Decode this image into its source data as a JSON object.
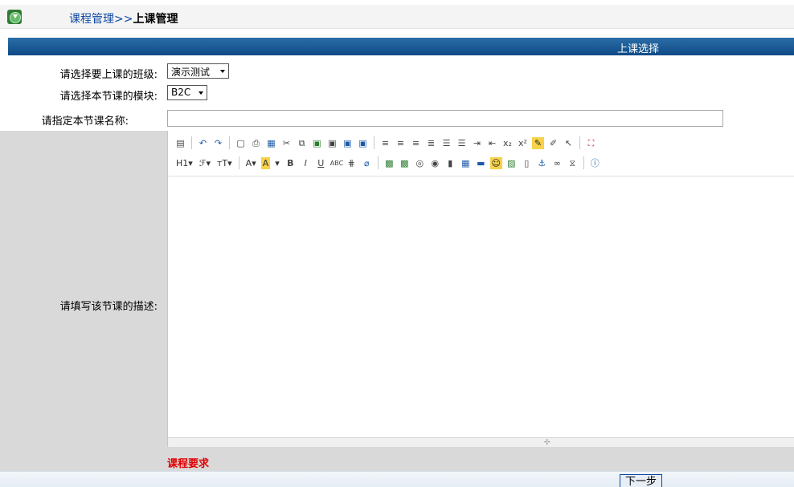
{
  "breadcrumb": {
    "parent": "课程管理",
    "separator": ">>",
    "current": "上课管理"
  },
  "section": {
    "title": "上课选择"
  },
  "form": {
    "class_label": "请选择要上课的班级:",
    "class_value": "演示测试",
    "module_label": "请选择本节课的模块:",
    "module_value": "B2C",
    "name_label": "请指定本节课名称:",
    "name_value": "",
    "desc_label": "请填写该节课的描述:",
    "requirement_label": "课程要求"
  },
  "editor": {
    "row1_icons": [
      "source-icon",
      "undo-icon",
      "redo-icon",
      "preview-icon",
      "print-icon",
      "template-icon",
      "cut-icon",
      "copy-icon",
      "paste-icon",
      "paste-text-icon",
      "paste-word-icon",
      "align-left-icon",
      "align-center-icon",
      "align-right-icon",
      "justify-icon",
      "ordered-list-icon",
      "unordered-list-icon",
      "indent-icon",
      "outdent-icon",
      "subscript-icon",
      "superscript-icon",
      "clear-format-icon",
      "select-all-icon",
      "cursor-icon",
      "fullscreen-icon"
    ],
    "row2_icons": [
      "heading-icon",
      "font-family-icon",
      "font-size-icon",
      "font-color-icon",
      "highlight-icon",
      "bold-icon",
      "italic-icon",
      "underline-icon",
      "strikethrough-icon",
      "line-height-icon",
      "remove-format-icon",
      "image-icon",
      "multi-image-icon",
      "flash-icon",
      "media-icon",
      "attachment-icon",
      "table-icon",
      "horizontal-rule-icon",
      "emoticon-icon",
      "baidu-map-icon",
      "page-break-icon",
      "anchor-icon",
      "link-icon",
      "unlink-icon",
      "about-icon"
    ],
    "h1_label": "H1",
    "font_label": "ℱ",
    "size_label": "тT"
  },
  "actions": {
    "next_label": "下一步"
  }
}
